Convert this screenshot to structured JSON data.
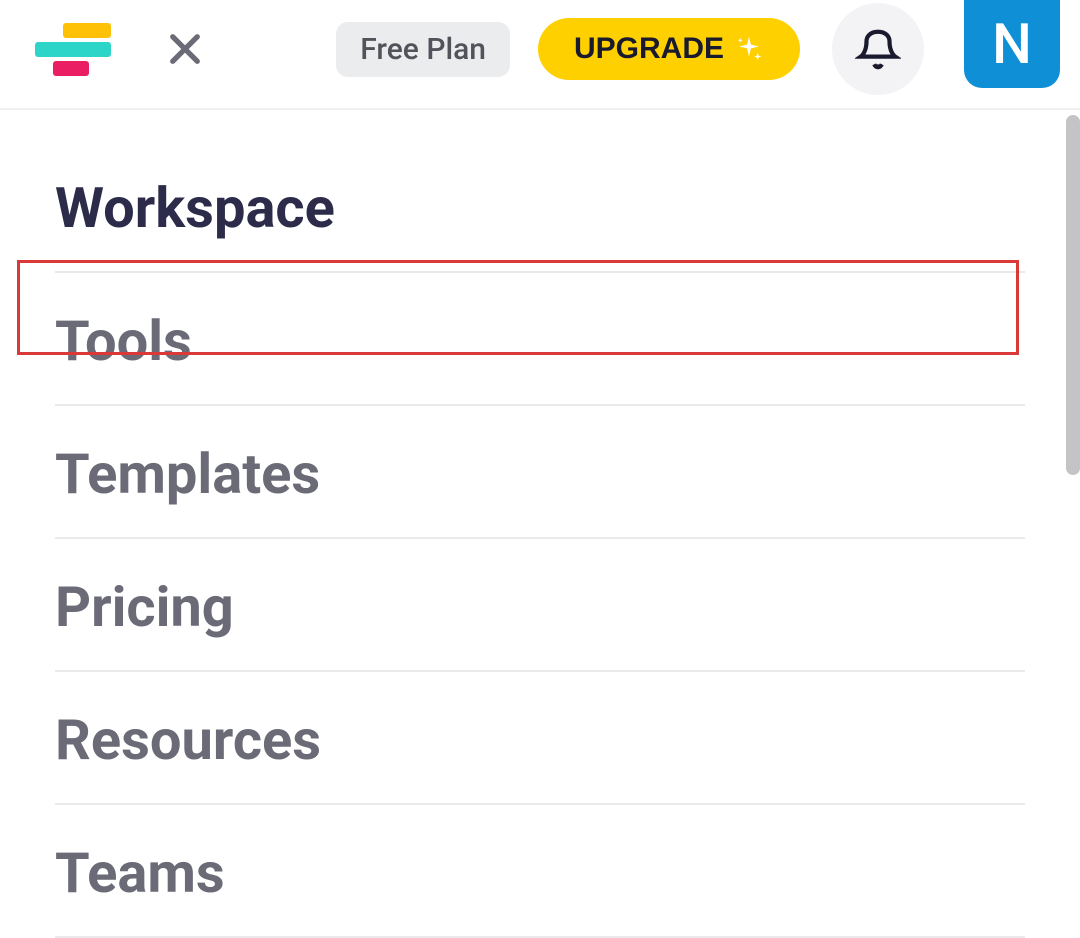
{
  "header": {
    "plan_badge": "Free Plan",
    "upgrade_label": "UPGRADE",
    "avatar_initial": "N"
  },
  "menu": {
    "items": [
      {
        "label": "Workspace",
        "active": true
      },
      {
        "label": "Tools",
        "active": false,
        "highlighted": true
      },
      {
        "label": "Templates",
        "active": false
      },
      {
        "label": "Pricing",
        "active": false
      },
      {
        "label": "Resources",
        "active": false
      },
      {
        "label": "Teams",
        "active": false
      }
    ]
  }
}
